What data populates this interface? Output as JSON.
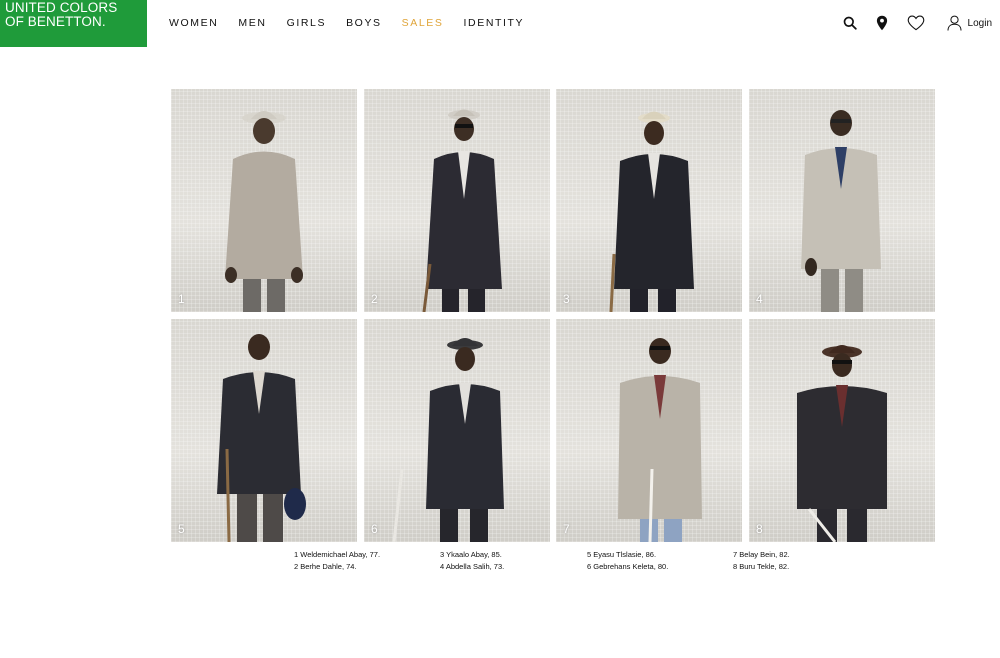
{
  "logo": {
    "line1": "UNITED COLORS",
    "line2": "OF BENETTON."
  },
  "nav": [
    {
      "label": "WOMEN"
    },
    {
      "label": "MEN"
    },
    {
      "label": "GIRLS"
    },
    {
      "label": "BOYS"
    },
    {
      "label": "SALES"
    },
    {
      "label": "IDENTITY"
    }
  ],
  "tools": {
    "search_icon": "search-icon",
    "location_icon": "location-pin-icon",
    "wishlist_icon": "heart-icon",
    "user_icon": "user-icon",
    "login_label": "Login"
  },
  "colors": {
    "brand_green": "#1f9b3a",
    "sales_accent": "#e0a53a"
  },
  "photos": [
    {
      "number": "1"
    },
    {
      "number": "2"
    },
    {
      "number": "3"
    },
    {
      "number": "4"
    },
    {
      "number": "5"
    },
    {
      "number": "6"
    },
    {
      "number": "7"
    },
    {
      "number": "8"
    }
  ],
  "captions": [
    {
      "line1": "1 Weldemichael Abay, 77.",
      "line2": "2 Berhe Dahle, 74."
    },
    {
      "line1": "3 Ykaalo Abay, 85.",
      "line2": "4 Abdella Salih, 73."
    },
    {
      "line1": "5 Eyasu Tlslasie, 86.",
      "line2": "6 Gebrehans Keleta, 80."
    },
    {
      "line1": "7 Belay Bein, 82.",
      "line2": "8 Buru Tekle, 82."
    }
  ]
}
